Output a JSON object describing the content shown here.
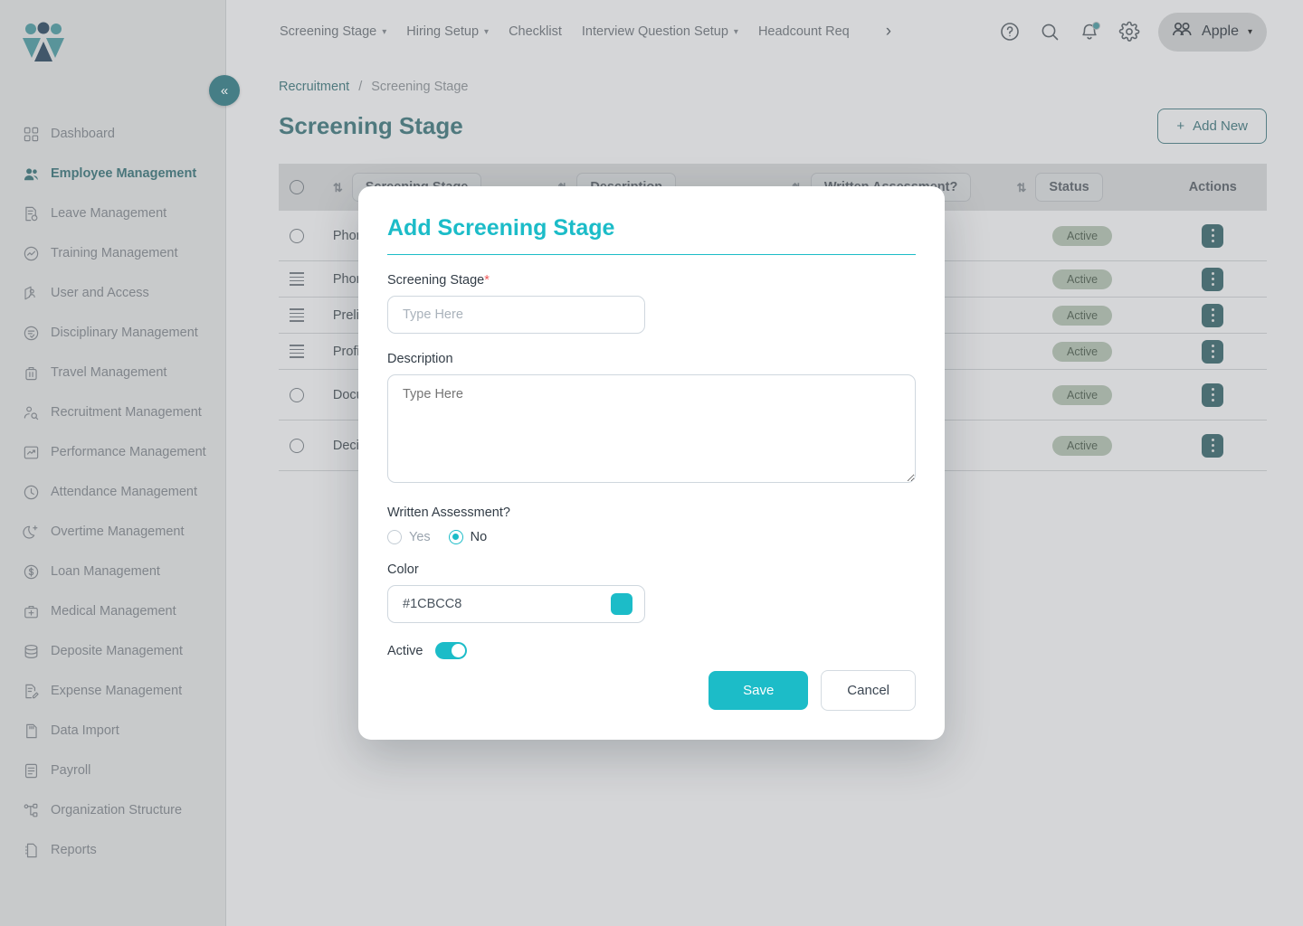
{
  "brand": {
    "logo_name": "company-logo",
    "accent": "#1CBCC8",
    "teal_dark": "#1C8F99"
  },
  "sidebar": {
    "collapse_label": "«",
    "items": [
      {
        "label": "Dashboard",
        "icon": "grid-icon",
        "active": false
      },
      {
        "label": "Employee Management",
        "icon": "people-icon",
        "active": true
      },
      {
        "label": "Leave Management",
        "icon": "document-clock-icon",
        "active": false
      },
      {
        "label": "Training Management",
        "icon": "chart-circle-icon",
        "active": false
      },
      {
        "label": "User and Access",
        "icon": "user-shield-icon",
        "active": false
      },
      {
        "label": "Disciplinary Management",
        "icon": "circle-check-icon",
        "active": false
      },
      {
        "label": "Travel Management",
        "icon": "suitcase-icon",
        "active": false
      },
      {
        "label": "Recruitment Management",
        "icon": "user-search-icon",
        "active": false
      },
      {
        "label": "Performance Management",
        "icon": "trend-box-icon",
        "active": false
      },
      {
        "label": "Attendance Management",
        "icon": "clock-icon",
        "active": false
      },
      {
        "label": "Overtime Management",
        "icon": "moon-plus-icon",
        "active": false
      },
      {
        "label": "Loan Management",
        "icon": "dollar-circle-icon",
        "active": false
      },
      {
        "label": "Medical Management",
        "icon": "medical-kit-icon",
        "active": false
      },
      {
        "label": "Deposite Management",
        "icon": "database-icon",
        "active": false
      },
      {
        "label": "Expense Management",
        "icon": "document-edit-icon",
        "active": false
      },
      {
        "label": "Data Import",
        "icon": "sd-card-icon",
        "active": false
      },
      {
        "label": "Payroll",
        "icon": "list-document-icon",
        "active": false
      },
      {
        "label": "Organization Structure",
        "icon": "org-tree-icon",
        "active": false
      },
      {
        "label": "Reports",
        "icon": "report-file-icon",
        "active": false
      }
    ]
  },
  "topbar": {
    "nav": [
      {
        "label": "Screening Stage",
        "has_caret": true
      },
      {
        "label": "Hiring Setup",
        "has_caret": true
      },
      {
        "label": "Checklist",
        "has_caret": false
      },
      {
        "label": "Interview Question Setup",
        "has_caret": true
      },
      {
        "label": "Headcount Req",
        "has_caret": false
      }
    ],
    "more_label": "›",
    "icons": [
      "help-icon",
      "search-icon",
      "notification-bell-icon",
      "gear-icon"
    ],
    "user": {
      "name": "Apple",
      "avatar_icon": "users-icon",
      "caret": "⌄"
    }
  },
  "breadcrumb": {
    "parent": "Recruitment",
    "separator": "/",
    "current": "Screening Stage"
  },
  "page": {
    "title": "Screening Stage",
    "add_new_label": "Add New",
    "add_new_plus": "+"
  },
  "table": {
    "columns": [
      {
        "label": "Screening Stage",
        "sortable": true
      },
      {
        "label": "Description",
        "sortable": true
      },
      {
        "label": "Written Assessment?",
        "sortable": true
      },
      {
        "label": "Status",
        "sortable": true
      },
      {
        "label": "Actions",
        "sortable": false
      }
    ],
    "rows": [
      {
        "handle": "checkbox",
        "name": "Phone Screening",
        "status": "Active"
      },
      {
        "handle": "drag",
        "name": "Phone Interview",
        "status": "Active"
      },
      {
        "handle": "drag",
        "name": "Preliminary Review",
        "status": "Active"
      },
      {
        "handle": "drag",
        "name": "Profile Screening",
        "status": "Active"
      },
      {
        "handle": "checkbox",
        "name": "Document Check",
        "status": "Active"
      },
      {
        "handle": "checkbox",
        "name": "Decision Stage",
        "status": "Active"
      }
    ]
  },
  "modal": {
    "title": "Add Screening Stage",
    "fields": {
      "screening_stage": {
        "label": "Screening Stage",
        "required_mark": "*",
        "value": "",
        "placeholder": "Type Here"
      },
      "description": {
        "label": "Description",
        "value": "",
        "placeholder": "Type Here"
      },
      "written_assessment": {
        "label": "Written Assessment?",
        "options": [
          {
            "label": "Yes",
            "selected": false
          },
          {
            "label": "No",
            "selected": true
          }
        ]
      },
      "color": {
        "label": "Color",
        "value": "#1CBCC8",
        "swatch": "#1CBCC8"
      },
      "active": {
        "label": "Active",
        "on": true
      }
    },
    "buttons": {
      "save": "Save",
      "cancel": "Cancel"
    }
  }
}
